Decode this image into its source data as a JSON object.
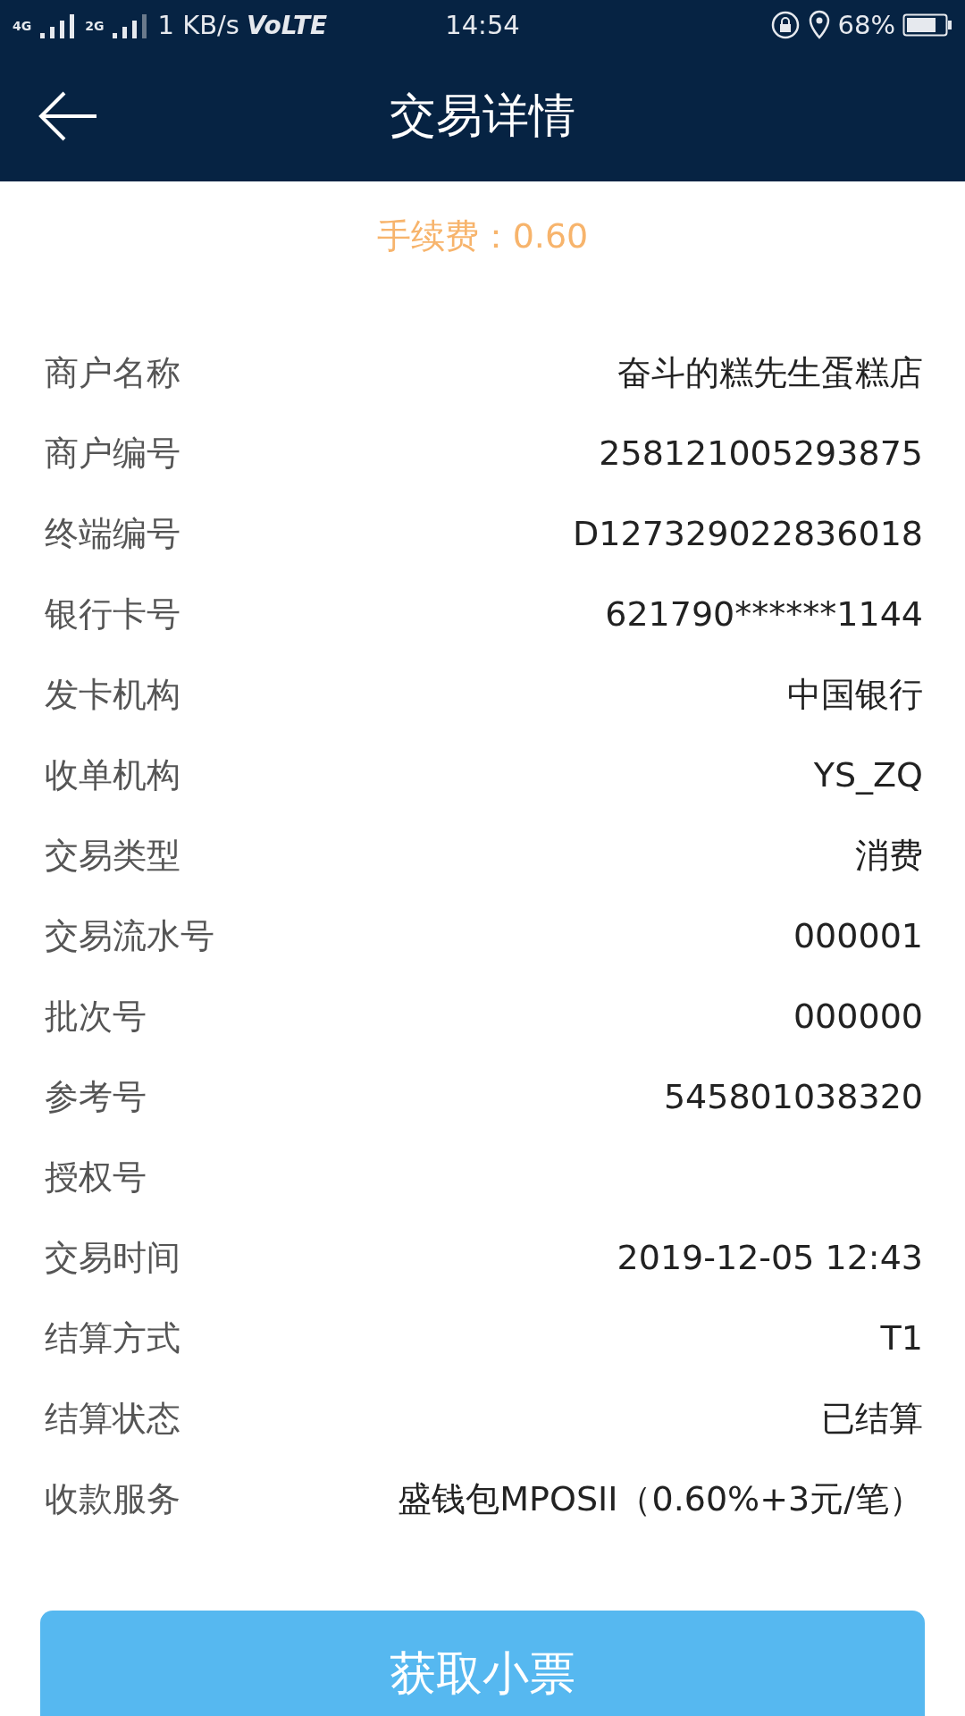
{
  "status_bar": {
    "network_1": "4G",
    "network_2": "2G",
    "speed": "1 KB/s",
    "volte": "VoLTE",
    "time": "14:54",
    "battery": "68%"
  },
  "header": {
    "title": "交易详情"
  },
  "fee": "手续费：0.60",
  "details": [
    {
      "label": "商户名称",
      "value": "奋斗的糕先生蛋糕店"
    },
    {
      "label": "商户编号",
      "value": "258121005293875"
    },
    {
      "label": "终端编号",
      "value": "D127329022836018"
    },
    {
      "label": "银行卡号",
      "value": "621790******1144"
    },
    {
      "label": "发卡机构",
      "value": "中国银行"
    },
    {
      "label": "收单机构",
      "value": "YS_ZQ"
    },
    {
      "label": "交易类型",
      "value": "消费"
    },
    {
      "label": "交易流水号",
      "value": "000001"
    },
    {
      "label": "批次号",
      "value": "000000"
    },
    {
      "label": "参考号",
      "value": "545801038320"
    },
    {
      "label": "授权号"
    },
    {
      "label": "交易时间",
      "value": "2019-12-05 12:43"
    },
    {
      "label": "结算方式",
      "value": "T1"
    },
    {
      "label": "结算状态",
      "value": "已结算"
    },
    {
      "label": "收款服务",
      "value": "盛钱包MPOSII（0.60%+3元/笔）"
    }
  ],
  "receipt_button": "获取小票"
}
